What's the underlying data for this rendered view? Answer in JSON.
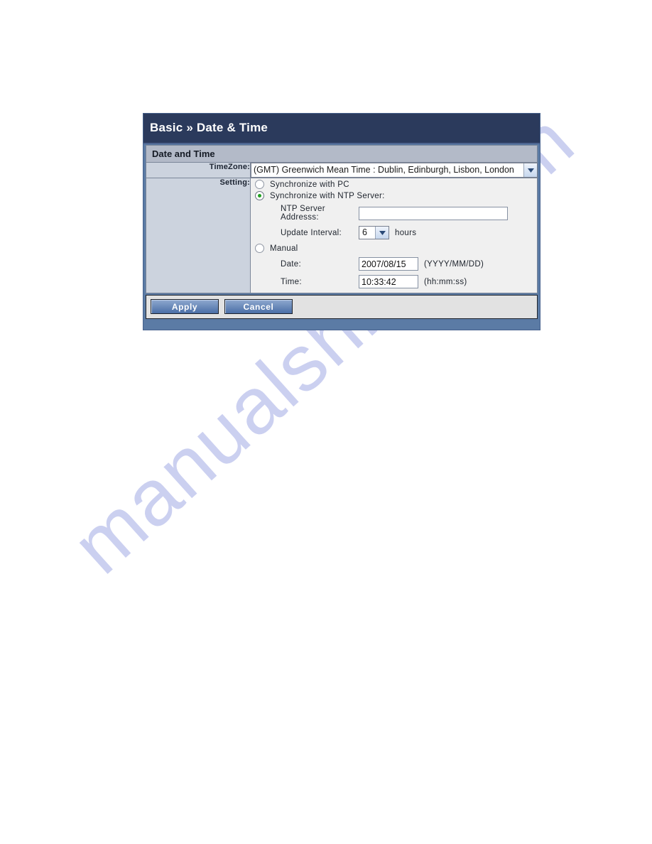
{
  "watermark": {
    "text": "manualshive.com"
  },
  "panel": {
    "title_prefix": "Basic",
    "title_separator": "»",
    "title_page": "Date & Time",
    "section_heading": "Date and Time"
  },
  "timezone_row": {
    "label": "TimeZone:",
    "selected": "(GMT) Greenwich Mean Time : Dublin, Edinburgh, Lisbon, London",
    "arrow_icon": "chevron-down-icon"
  },
  "setting_row": {
    "label": "Setting:",
    "options": [
      {
        "id": "sync-pc",
        "label": "Synchronize with PC",
        "checked": false
      },
      {
        "id": "sync-ntp",
        "label": "Synchronize with NTP Server:",
        "checked": true
      },
      {
        "id": "manual",
        "label": "Manual",
        "checked": false
      }
    ],
    "ntp_server": {
      "label": "NTP Server Addresss:",
      "value": "",
      "placeholder": ""
    },
    "update_interval": {
      "label": "Update Interval:",
      "value": "6",
      "unit": "hours",
      "arrow_icon": "chevron-down-icon"
    },
    "manual_date": {
      "label": "Date:",
      "value": "2007/08/15",
      "format_hint": "(YYYY/MM/DD)"
    },
    "manual_time": {
      "label": "Time:",
      "value": "10:33:42",
      "format_hint": "(hh:mm:ss)"
    }
  },
  "footer": {
    "apply_label": "Apply",
    "cancel_label": "Cancel"
  },
  "colors": {
    "title_bar": "#2b3a5c",
    "panel_frame": "#5b7ba5",
    "section_head": "#b3bac8",
    "label_column": "#ccd3de",
    "field_background": "#f0f0f0",
    "radio_selected": "#21a021",
    "watermark": "#c3c8ee"
  }
}
